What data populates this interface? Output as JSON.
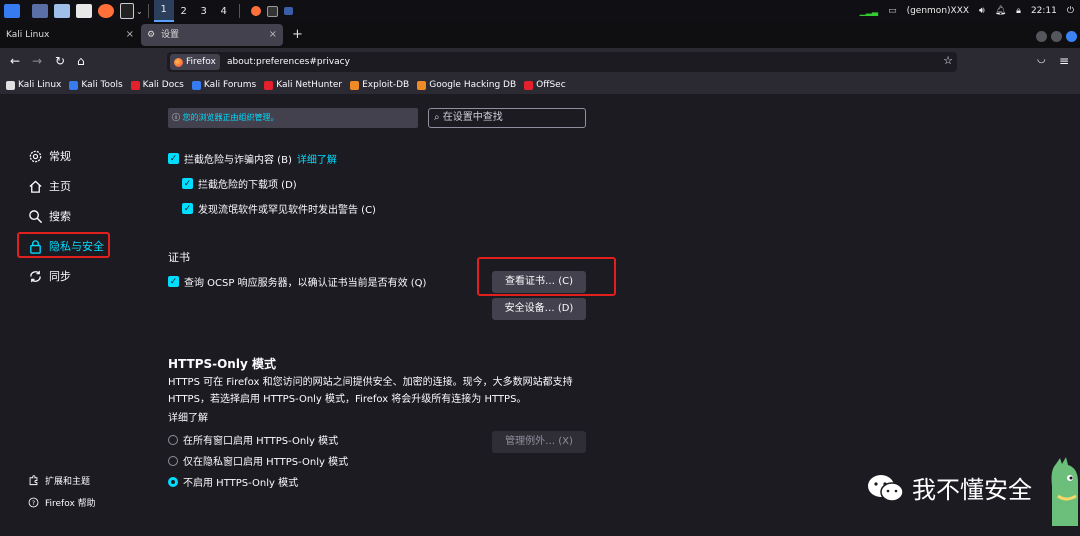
{
  "panel": {
    "workspaces": [
      "1",
      "2",
      "3",
      "4"
    ],
    "genmon": "(genmon)XXX",
    "clock": "22:11"
  },
  "tabs": [
    {
      "label": "Kali Linux",
      "close": "×"
    },
    {
      "label": "设置",
      "close": "×"
    }
  ],
  "new_tab": "+",
  "nav": {
    "identity": "Firefox",
    "url": "about:preferences#privacy"
  },
  "bookmarks": [
    {
      "label": "Kali Linux",
      "color": "#e0e0e0"
    },
    {
      "label": "Kali Tools",
      "color": "#367bf0"
    },
    {
      "label": "Kali Docs",
      "color": "#e5202d"
    },
    {
      "label": "Kali Forums",
      "color": "#367bf0"
    },
    {
      "label": "Kali NetHunter",
      "color": "#e5202d"
    },
    {
      "label": "Exploit-DB",
      "color": "#f08a24"
    },
    {
      "label": "Google Hacking DB",
      "color": "#f08a24"
    },
    {
      "label": "OffSec",
      "color": "#e5202d"
    }
  ],
  "policy_notice": "您的浏览器正由组织管理。",
  "search_placeholder": "在设置中查找",
  "sidebar": {
    "items": [
      {
        "label": "常规",
        "icon": "gear-icon"
      },
      {
        "label": "主页",
        "icon": "home-icon"
      },
      {
        "label": "搜索",
        "icon": "search-icon"
      },
      {
        "label": "隐私与安全",
        "icon": "lock-icon"
      },
      {
        "label": "同步",
        "icon": "sync-icon"
      }
    ],
    "footer": [
      {
        "label": "扩展和主题",
        "icon": "puzzle-icon"
      },
      {
        "label": "Firefox 帮助",
        "icon": "help-icon"
      }
    ]
  },
  "deceptive": {
    "block_dangerous": "拦截危险与诈骗内容 (B)",
    "learn_more": "详细了解",
    "block_downloads": "拦截危险的下载项 (D)",
    "warn_unwanted": "发现流氓软件或罕见软件时发出警告 (C)"
  },
  "certificates": {
    "heading": "证书",
    "ocsp": "查询 OCSP 响应服务器，以确认证书当前是否有效 (Q)",
    "view_button": "查看证书… (C)",
    "devices_button": "安全设备… (D)"
  },
  "https_only": {
    "heading": "HTTPS-Only 模式",
    "desc1": "HTTPS 可在 Firefox 和您访问的网站之间提供安全、加密的连接。现今，大多数网站都支持",
    "desc2": "HTTPS，若选择启用 HTTPS-Only 模式，Firefox 将会升级所有连接为 HTTPS。",
    "learn_more": "详细了解",
    "opt_all": "在所有窗口启用 HTTPS-Only 模式",
    "opt_private": "仅在隐私窗口启用 HTTPS-Only 模式",
    "opt_off": "不启用 HTTPS-Only 模式",
    "exceptions_button": "管理例外… (X)"
  },
  "watermark": "我不懂安全",
  "colors": {
    "accent": "#00ddff",
    "highlight": "#e0201e"
  }
}
